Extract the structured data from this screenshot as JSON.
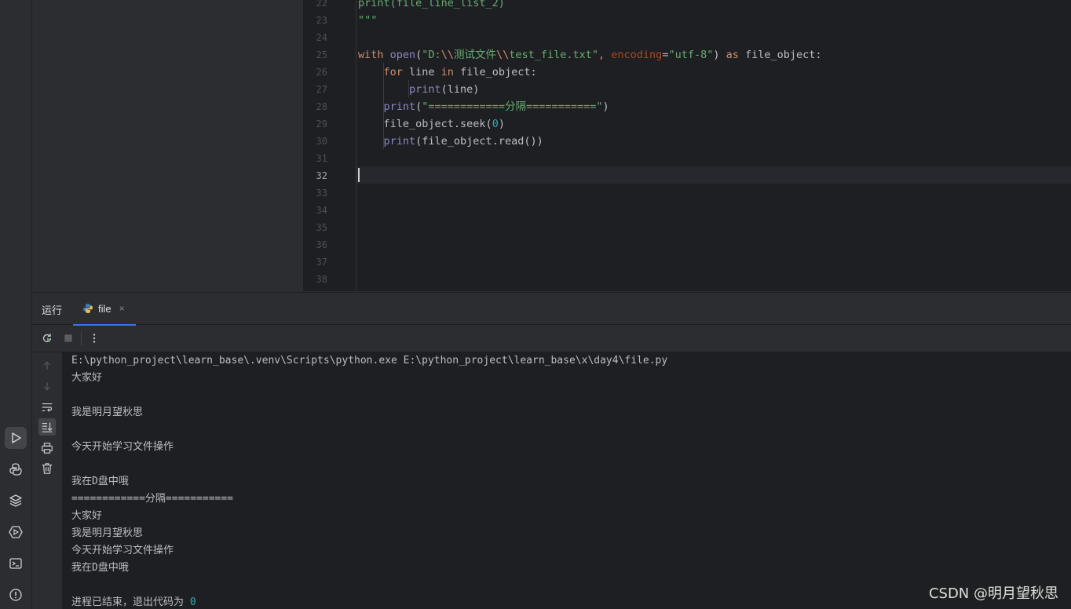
{
  "toolbar_icons": [
    {
      "name": "run-icon",
      "active": true
    },
    {
      "name": "python-console-icon",
      "active": false
    },
    {
      "name": "python-packages-icon",
      "active": false
    },
    {
      "name": "services-icon",
      "active": false
    },
    {
      "name": "terminal-icon",
      "active": false
    },
    {
      "name": "problems-icon",
      "active": false
    }
  ],
  "editor": {
    "current_line": "32",
    "lines": [
      {
        "n": "22",
        "tokens": [
          {
            "t": "print(file_line_list_2)",
            "c": "str"
          }
        ]
      },
      {
        "n": "23",
        "tokens": [
          {
            "t": "\"\"\"",
            "c": "str"
          }
        ]
      },
      {
        "n": "24",
        "tokens": []
      },
      {
        "n": "25",
        "tokens": [
          {
            "t": "with ",
            "c": "kw"
          },
          {
            "t": "open",
            "c": "fn"
          },
          {
            "t": "(",
            "c": ""
          },
          {
            "t": "\"D:",
            "c": "str"
          },
          {
            "t": "\\\\",
            "c": "esc"
          },
          {
            "t": "测试文件",
            "c": "str"
          },
          {
            "t": "\\\\",
            "c": "esc"
          },
          {
            "t": "test_file.txt\"",
            "c": "str"
          },
          {
            "t": ", ",
            "c": "kw"
          },
          {
            "t": "encoding",
            "c": "param"
          },
          {
            "t": "=",
            "c": ""
          },
          {
            "t": "\"utf-8\"",
            "c": "str"
          },
          {
            "t": ") ",
            "c": ""
          },
          {
            "t": "as ",
            "c": "kw"
          },
          {
            "t": "file_object:",
            "c": ""
          }
        ]
      },
      {
        "n": "26",
        "tokens": [
          {
            "t": "    ",
            "c": ""
          },
          {
            "t": "for ",
            "c": "kw"
          },
          {
            "t": "line ",
            "c": ""
          },
          {
            "t": "in ",
            "c": "kw"
          },
          {
            "t": "file_object:",
            "c": ""
          }
        ]
      },
      {
        "n": "27",
        "tokens": [
          {
            "t": "        ",
            "c": ""
          },
          {
            "t": "print",
            "c": "fn"
          },
          {
            "t": "(line)",
            "c": ""
          }
        ]
      },
      {
        "n": "28",
        "tokens": [
          {
            "t": "    ",
            "c": ""
          },
          {
            "t": "print",
            "c": "fn"
          },
          {
            "t": "(",
            "c": ""
          },
          {
            "t": "\"============分隔===========\"",
            "c": "str"
          },
          {
            "t": ")",
            "c": ""
          }
        ]
      },
      {
        "n": "29",
        "tokens": [
          {
            "t": "    file_object.seek(",
            "c": ""
          },
          {
            "t": "0",
            "c": "num"
          },
          {
            "t": ")",
            "c": ""
          }
        ]
      },
      {
        "n": "30",
        "tokens": [
          {
            "t": "    ",
            "c": ""
          },
          {
            "t": "print",
            "c": "fn"
          },
          {
            "t": "(file_object.read())",
            "c": ""
          }
        ]
      },
      {
        "n": "31",
        "tokens": []
      },
      {
        "n": "32",
        "tokens": []
      },
      {
        "n": "33",
        "tokens": []
      },
      {
        "n": "34",
        "tokens": []
      },
      {
        "n": "35",
        "tokens": []
      },
      {
        "n": "36",
        "tokens": []
      },
      {
        "n": "37",
        "tokens": []
      },
      {
        "n": "38",
        "tokens": []
      }
    ]
  },
  "run_window": {
    "title": "运行",
    "tab_label": "file",
    "tab_close": "×",
    "console_lines": [
      "E:\\python_project\\learn_base\\.venv\\Scripts\\python.exe E:\\python_project\\learn_base\\x\\day4\\file.py",
      "大家好",
      "",
      "我是明月望秋思",
      "",
      "今天开始学习文件操作",
      "",
      "我在D盘中哦",
      "============分隔===========",
      "大家好",
      "我是明月望秋思",
      "今天开始学习文件操作",
      "我在D盘中哦",
      "",
      "进程已结束，退出代码为 "
    ],
    "exit_code": "0"
  },
  "watermark": "CSDN @明月望秋思"
}
